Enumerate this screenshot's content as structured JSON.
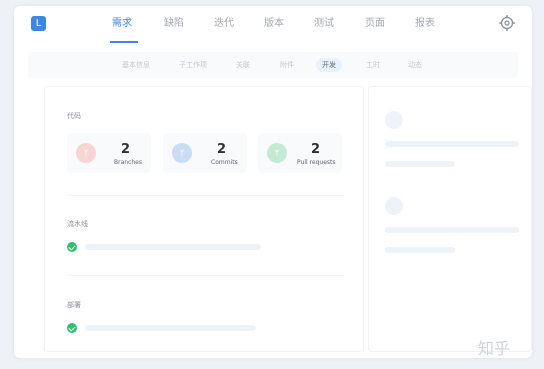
{
  "logo": {
    "glyph": "L"
  },
  "nav": {
    "tabs": [
      {
        "label": "需求"
      },
      {
        "label": "缺陷"
      },
      {
        "label": "迭代"
      },
      {
        "label": "版本"
      },
      {
        "label": "测试"
      },
      {
        "label": "页面"
      },
      {
        "label": "报表"
      }
    ],
    "active_index": 0
  },
  "subnav": {
    "tabs": [
      {
        "label": "基本信息"
      },
      {
        "label": "子工作项"
      },
      {
        "label": "关联"
      },
      {
        "label": "附件"
      },
      {
        "label": "开发"
      },
      {
        "label": "工时"
      },
      {
        "label": "动态"
      }
    ],
    "active_index": 4
  },
  "code_section": {
    "title": "代码",
    "stats": [
      {
        "icon": "branch-icon",
        "icon_glyph": "ᛘ",
        "value": "2",
        "label": "Branches",
        "color": "#f6d5d2"
      },
      {
        "icon": "commit-icon",
        "icon_glyph": "ᛘ",
        "value": "2",
        "label": "Commits",
        "color": "#c9ddf4"
      },
      {
        "icon": "pull-request-icon",
        "icon_glyph": "ᛘ",
        "value": "2",
        "label": "Pull requests",
        "color": "#c4ead5"
      }
    ]
  },
  "pipeline_section": {
    "title": "流水线"
  },
  "deploy_section": {
    "title": "部署"
  },
  "colors": {
    "accent": "#3f86e0",
    "success": "#2fbf71"
  },
  "watermark": {
    "text": "知乎"
  }
}
